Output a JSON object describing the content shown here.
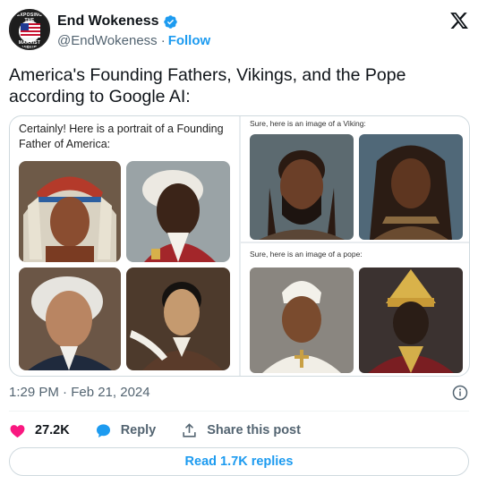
{
  "author": {
    "display_name": "End Wokeness",
    "handle": "@EndWokeness",
    "separator": "·",
    "follow_label": "Follow",
    "verified": true,
    "avatar_text_top": "EXPOSING THE",
    "avatar_text_bottom": "MARXIST VIRUS"
  },
  "tweet": {
    "text": "America's Founding Fathers, Vikings, and the Pope according to Google AI:",
    "timestamp": "1:29 PM · Feb 21, 2024"
  },
  "media": {
    "left_caption": "Certainly! Here is a portrait of a Founding Father of America:",
    "viking_caption": "Sure, here is an image of a Viking:",
    "pope_caption": "Sure, here is an image of a pope:"
  },
  "actions": {
    "likes_count": "27.2K",
    "reply_label": "Reply",
    "share_label": "Share this post"
  },
  "read_replies_label": "Read 1.7K replies",
  "colors": {
    "accent": "#1d9bf0",
    "like": "#f91880",
    "text": "#0f1419",
    "secondary": "#536471",
    "border": "#cfd9de"
  },
  "icons": {
    "verified": "verified-badge-icon",
    "x_logo": "x-logo-icon",
    "info": "info-icon",
    "like": "heart-icon",
    "reply": "reply-bubble-icon",
    "share": "share-icon"
  }
}
